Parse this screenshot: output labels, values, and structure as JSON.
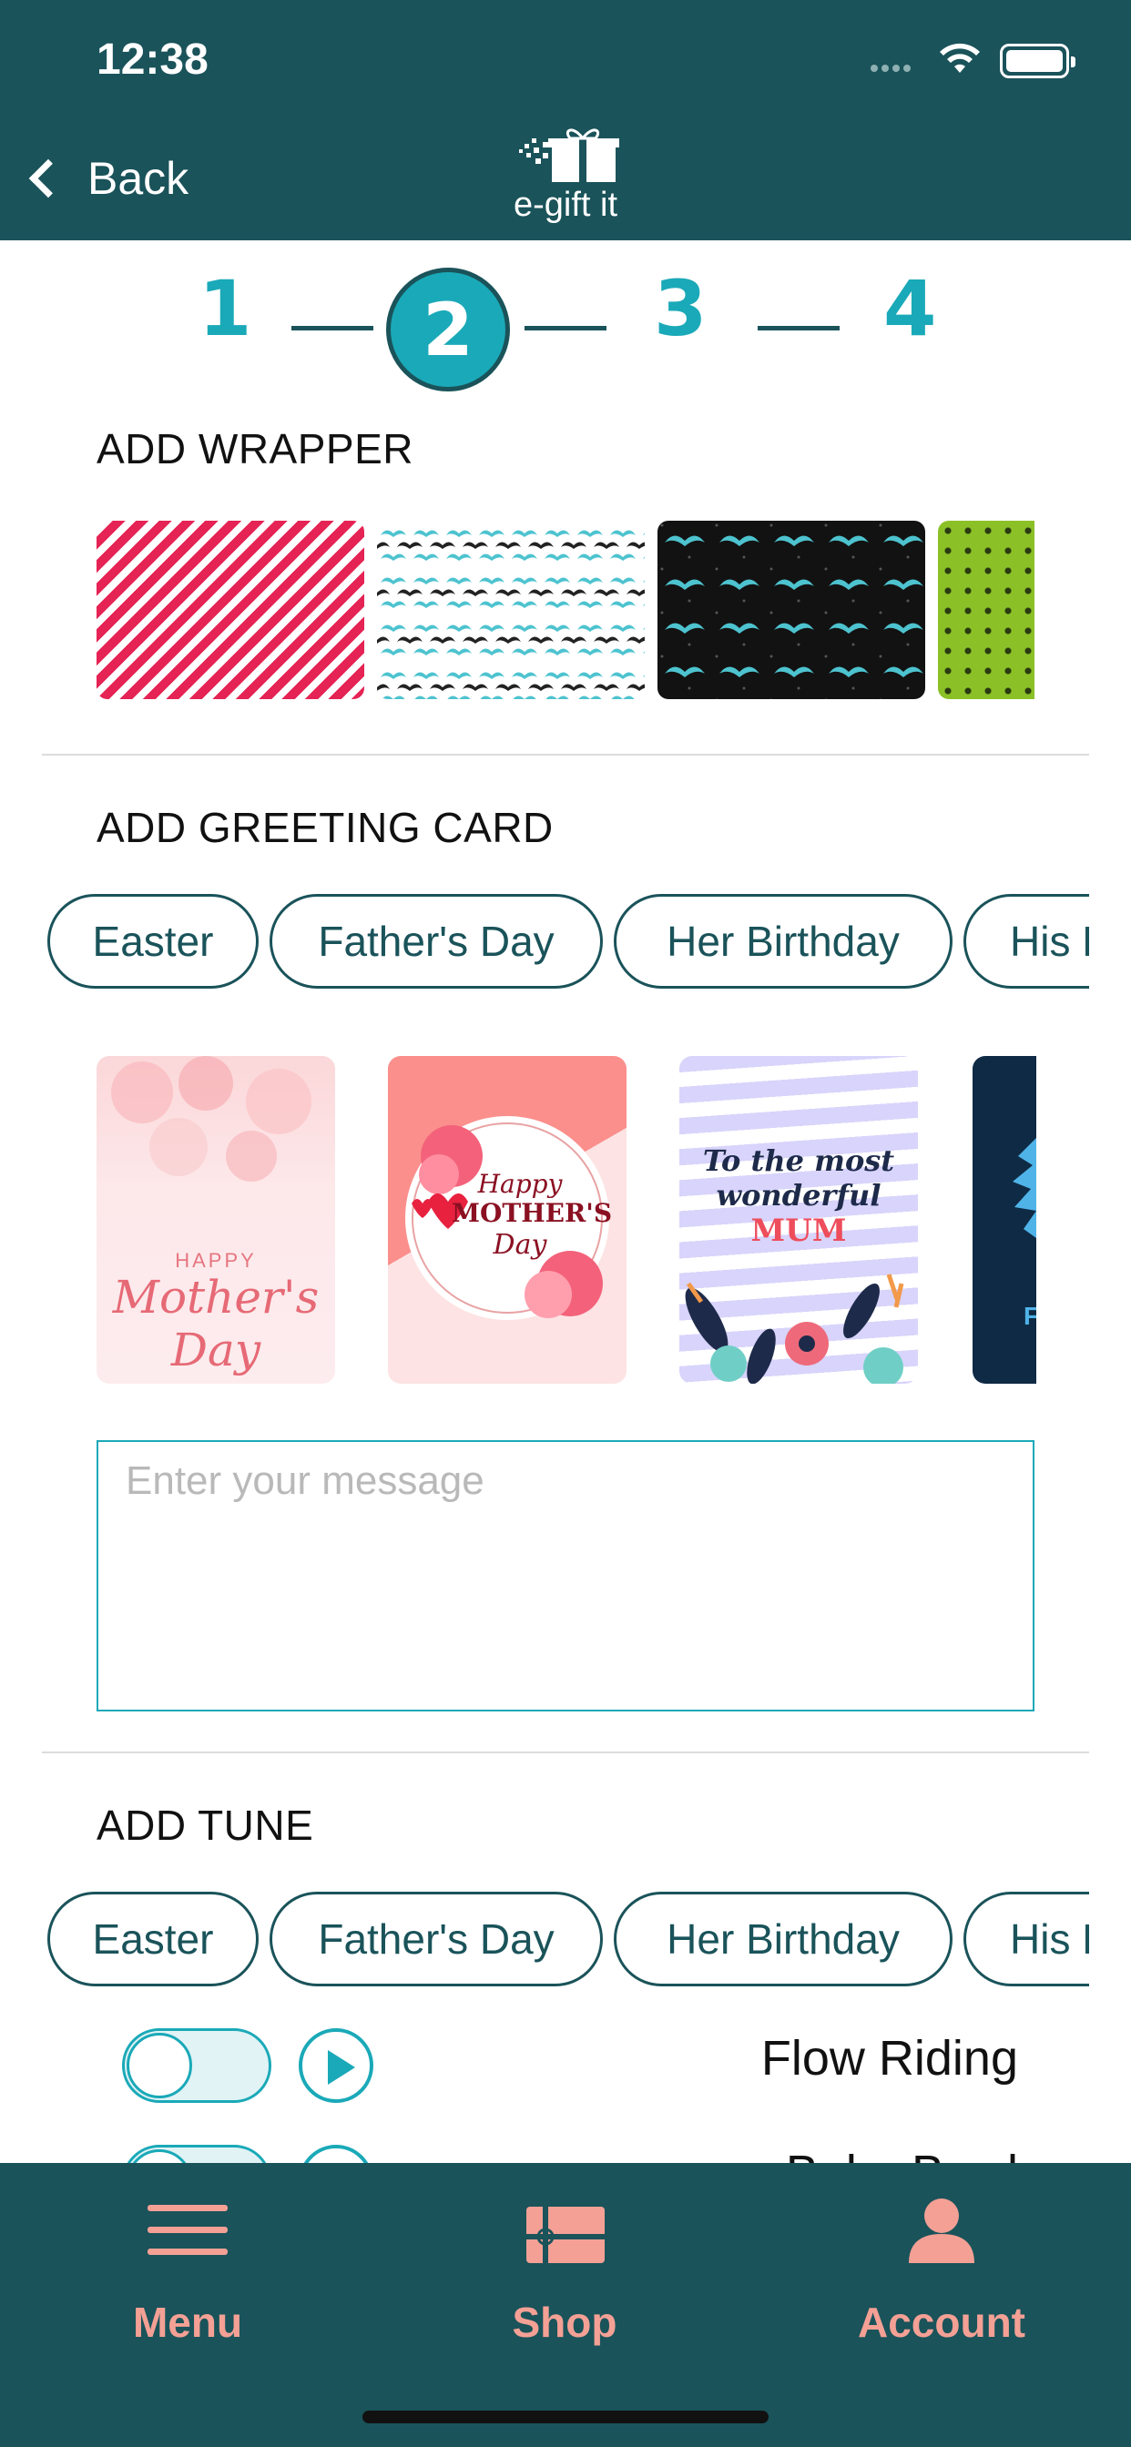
{
  "status_bar": {
    "time": "12:38"
  },
  "header": {
    "back_label": "Back",
    "logo_text": "e-gift it"
  },
  "steps": {
    "items": [
      "1",
      "2",
      "3",
      "4"
    ],
    "active": "2"
  },
  "wrapper_section": {
    "title": "ADD WRAPPER",
    "wrappers": [
      "red-white-stripes",
      "mustache-pattern-light",
      "mustache-pattern-dark",
      "green-polka-dots"
    ]
  },
  "greeting_section": {
    "title": "ADD GREETING CARD",
    "chips": [
      "Easter",
      "Father's Day",
      "Her Birthday",
      "His Birthday"
    ],
    "cards": [
      {
        "happy": "HAPPY",
        "text": "Mother's Day"
      },
      {
        "text_1": "Happy",
        "text_2": "MOTHER'S",
        "text_3": "Day"
      },
      {
        "text_1": "To the most",
        "text_2": "wonderful",
        "text_3": "MUM"
      },
      {
        "text": "F"
      }
    ],
    "message_placeholder": "Enter your message"
  },
  "tune_section": {
    "title": "ADD TUNE",
    "chips": [
      "Easter",
      "Father's Day",
      "Her Birthday",
      "His Birthday"
    ],
    "tunes": [
      {
        "name": "Flow Riding",
        "enabled": false
      },
      {
        "name": "Baby Bowl",
        "enabled": false
      }
    ]
  },
  "bottom_nav": {
    "items": [
      {
        "label": "Menu",
        "icon": "hamburger-menu-icon"
      },
      {
        "label": "Shop",
        "icon": "gift-card-icon"
      },
      {
        "label": "Account",
        "icon": "user-icon"
      }
    ]
  },
  "colors": {
    "brand": "#1a535a",
    "accent": "#1aa9b8",
    "nav_label": "#f4a095"
  }
}
